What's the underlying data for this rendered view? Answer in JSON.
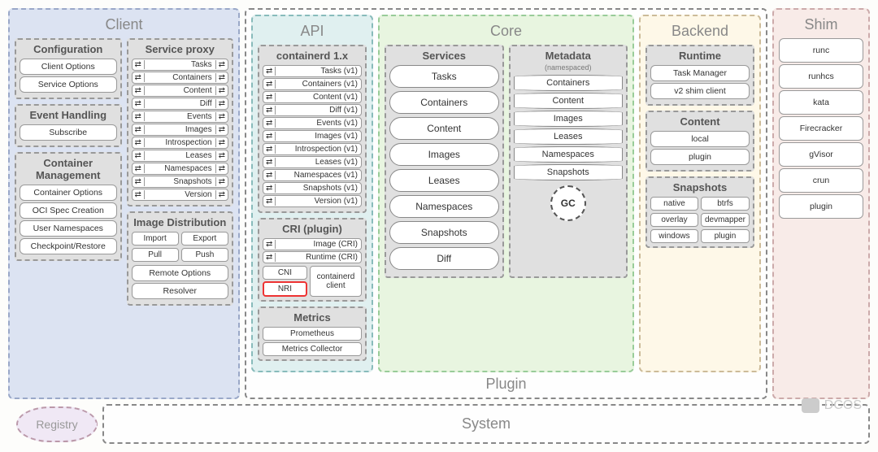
{
  "regions": {
    "client": "Client",
    "api": "API",
    "core": "Core",
    "backend": "Backend",
    "shim": "Shim",
    "plugin": "Plugin",
    "system": "System",
    "registry": "Registry"
  },
  "client": {
    "config": {
      "title": "Configuration",
      "items": [
        "Client Options",
        "Service Options"
      ]
    },
    "events": {
      "title": "Event Handling",
      "items": [
        "Subscribe"
      ]
    },
    "mgmt": {
      "title": "Container Management",
      "items": [
        "Container Options",
        "OCI Spec Creation",
        "User Namespaces",
        "Checkpoint/Restore"
      ]
    },
    "proxy": {
      "title": "Service proxy",
      "items": [
        "Tasks",
        "Containers",
        "Content",
        "Diff",
        "Events",
        "Images",
        "Introspection",
        "Leases",
        "Namespaces",
        "Snapshots",
        "Version"
      ]
    },
    "dist": {
      "title": "Image Distribution",
      "pairs": [
        [
          "Import",
          "Export"
        ],
        [
          "Pull",
          "Push"
        ]
      ],
      "remote": "Remote Options",
      "resolver": "Resolver"
    }
  },
  "api": {
    "cd": {
      "title": "containerd 1.x",
      "items": [
        "Tasks (v1)",
        "Containers (v1)",
        "Content (v1)",
        "Diff (v1)",
        "Events (v1)",
        "Images (v1)",
        "Introspection (v1)",
        "Leases (v1)",
        "Namespaces (v1)",
        "Snapshots (v1)",
        "Version (v1)"
      ]
    },
    "cri": {
      "title": "CRI (plugin)",
      "rows": [
        "Image (CRI)",
        "Runtime (CRI)"
      ],
      "cni": "CNI",
      "nri": "NRI",
      "client": "containerd client"
    },
    "metrics": {
      "title": "Metrics",
      "items": [
        "Prometheus",
        "Metrics Collector"
      ]
    }
  },
  "core": {
    "services": {
      "title": "Services",
      "items": [
        "Tasks",
        "Containers",
        "Content",
        "Images",
        "Leases",
        "Namespaces",
        "Snapshots",
        "Diff"
      ]
    },
    "metadata": {
      "title": "Metadata",
      "sub": "(namespaced)",
      "items": [
        "Containers",
        "Content",
        "Images",
        "Leases",
        "Namespaces",
        "Snapshots"
      ],
      "gc": "GC"
    }
  },
  "backend": {
    "runtime": {
      "title": "Runtime",
      "items": [
        "Task Manager",
        "v2 shim client"
      ]
    },
    "content": {
      "title": "Content",
      "items": [
        "local",
        "plugin"
      ]
    },
    "snapshots": {
      "title": "Snapshots",
      "grid": [
        "native",
        "btrfs",
        "overlay",
        "devmapper",
        "windows",
        "plugin"
      ]
    }
  },
  "shim": {
    "items": [
      "runc",
      "runhcs",
      "kata",
      "Firecracker",
      "gVisor",
      "crun",
      "plugin"
    ]
  },
  "watermark": "DCOS"
}
